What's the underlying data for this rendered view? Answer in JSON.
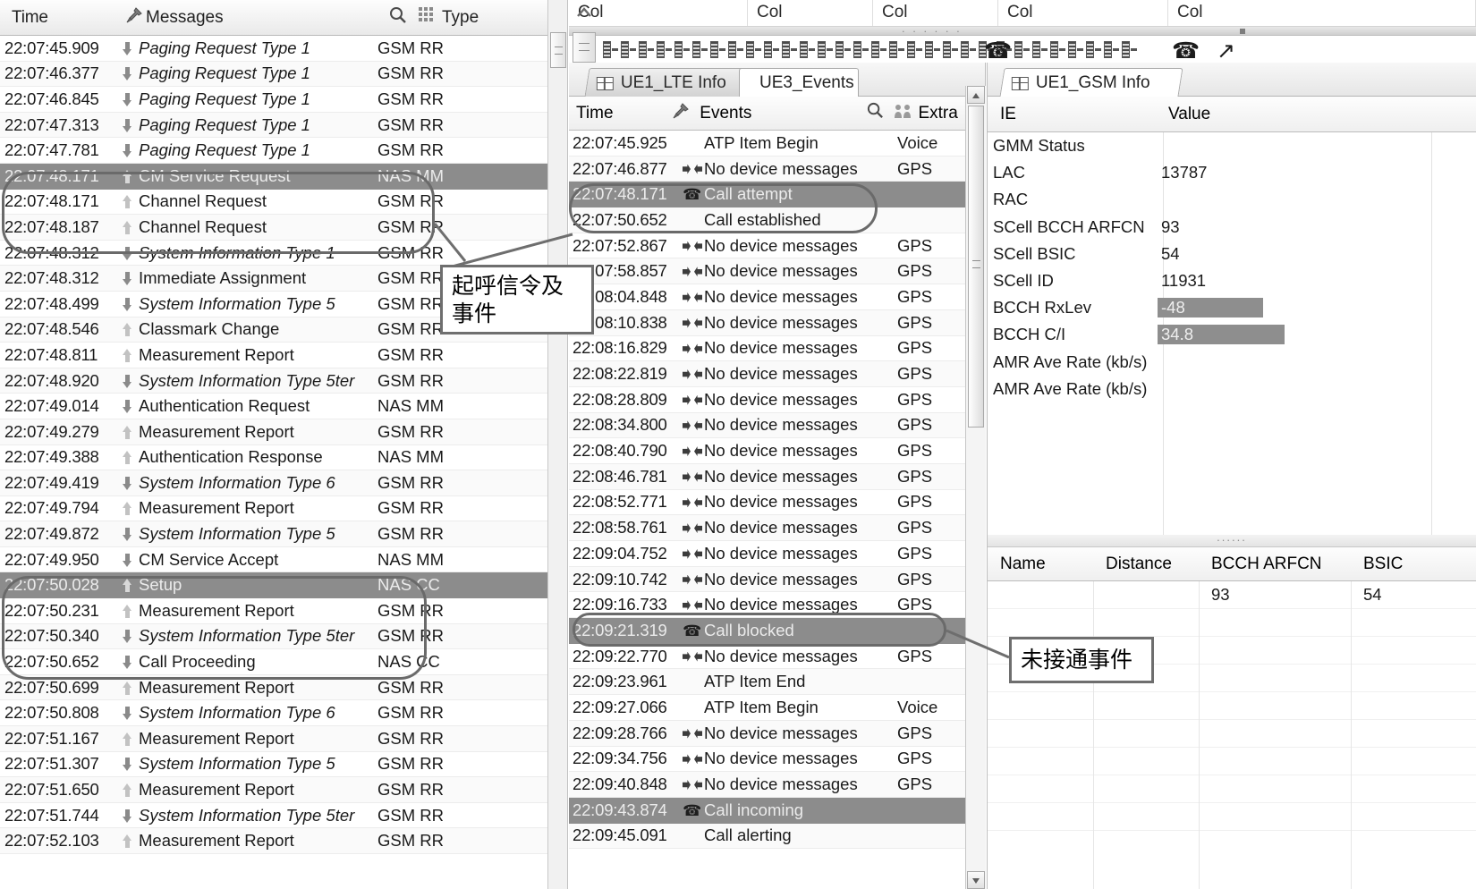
{
  "messages_panel": {
    "columns": [
      "Time",
      "Messages",
      "Type"
    ],
    "pin_icon": "pin-icon",
    "search_icon": "search-icon",
    "grid_icon": "grid-icon",
    "rows": [
      {
        "time": "22:07:45.909",
        "dir": "down",
        "msg": "Paging Request Type 1",
        "italic": true,
        "type": "GSM RR",
        "selected": false
      },
      {
        "time": "22:07:46.377",
        "dir": "down",
        "msg": "Paging Request Type 1",
        "italic": true,
        "type": "GSM RR",
        "selected": false
      },
      {
        "time": "22:07:46.845",
        "dir": "down",
        "msg": "Paging Request Type 1",
        "italic": true,
        "type": "GSM RR",
        "selected": false
      },
      {
        "time": "22:07:47.313",
        "dir": "down",
        "msg": "Paging Request Type 1",
        "italic": true,
        "type": "GSM RR",
        "selected": false
      },
      {
        "time": "22:07:47.781",
        "dir": "down",
        "msg": "Paging Request Type 1",
        "italic": true,
        "type": "GSM RR",
        "selected": false
      },
      {
        "time": "22:07:48.171",
        "dir": "up",
        "msg": "CM Service Request",
        "italic": false,
        "type": "NAS MM",
        "selected": true
      },
      {
        "time": "22:07:48.171",
        "dir": "up",
        "msg": "Channel Request",
        "italic": false,
        "type": "GSM RR",
        "selected": false
      },
      {
        "time": "22:07:48.187",
        "dir": "up",
        "msg": "Channel Request",
        "italic": false,
        "type": "GSM RR",
        "selected": false
      },
      {
        "time": "22:07:48.312",
        "dir": "down",
        "msg": "System Information Type 1",
        "italic": true,
        "type": "GSM RR",
        "selected": false
      },
      {
        "time": "22:07:48.312",
        "dir": "down",
        "msg": "Immediate Assignment",
        "italic": false,
        "type": "GSM RR",
        "selected": false
      },
      {
        "time": "22:07:48.499",
        "dir": "down",
        "msg": "System Information Type 5",
        "italic": true,
        "type": "GSM RR",
        "selected": false
      },
      {
        "time": "22:07:48.546",
        "dir": "up",
        "msg": "Classmark Change",
        "italic": false,
        "type": "GSM RR",
        "selected": false
      },
      {
        "time": "22:07:48.811",
        "dir": "up",
        "msg": "Measurement Report",
        "italic": false,
        "type": "GSM RR",
        "selected": false
      },
      {
        "time": "22:07:48.920",
        "dir": "down",
        "msg": "System Information Type 5ter",
        "italic": true,
        "type": "GSM RR",
        "selected": false
      },
      {
        "time": "22:07:49.014",
        "dir": "down",
        "msg": "Authentication Request",
        "italic": false,
        "type": "NAS MM",
        "selected": false
      },
      {
        "time": "22:07:49.279",
        "dir": "up",
        "msg": "Measurement Report",
        "italic": false,
        "type": "GSM RR",
        "selected": false
      },
      {
        "time": "22:07:49.388",
        "dir": "up",
        "msg": "Authentication Response",
        "italic": false,
        "type": "NAS MM",
        "selected": false
      },
      {
        "time": "22:07:49.419",
        "dir": "down",
        "msg": "System Information Type 6",
        "italic": true,
        "type": "GSM RR",
        "selected": false
      },
      {
        "time": "22:07:49.794",
        "dir": "up",
        "msg": "Measurement Report",
        "italic": false,
        "type": "GSM RR",
        "selected": false
      },
      {
        "time": "22:07:49.872",
        "dir": "down",
        "msg": "System Information Type 5",
        "italic": true,
        "type": "GSM RR",
        "selected": false
      },
      {
        "time": "22:07:49.950",
        "dir": "down",
        "msg": "CM Service Accept",
        "italic": false,
        "type": "NAS MM",
        "selected": false
      },
      {
        "time": "22:07:50.028",
        "dir": "up",
        "msg": "Setup",
        "italic": false,
        "type": "NAS CC",
        "selected": true
      },
      {
        "time": "22:07:50.231",
        "dir": "up",
        "msg": "Measurement Report",
        "italic": false,
        "type": "GSM RR",
        "selected": false
      },
      {
        "time": "22:07:50.340",
        "dir": "down",
        "msg": "System Information Type 5ter",
        "italic": true,
        "type": "GSM RR",
        "selected": false
      },
      {
        "time": "22:07:50.652",
        "dir": "down",
        "msg": "Call Proceeding",
        "italic": false,
        "type": "NAS CC",
        "selected": false
      },
      {
        "time": "22:07:50.699",
        "dir": "up",
        "msg": "Measurement Report",
        "italic": false,
        "type": "GSM RR",
        "selected": false
      },
      {
        "time": "22:07:50.808",
        "dir": "down",
        "msg": "System Information Type 6",
        "italic": true,
        "type": "GSM RR",
        "selected": false
      },
      {
        "time": "22:07:51.167",
        "dir": "up",
        "msg": "Measurement Report",
        "italic": false,
        "type": "GSM RR",
        "selected": false
      },
      {
        "time": "22:07:51.307",
        "dir": "down",
        "msg": "System Information Type 5",
        "italic": true,
        "type": "GSM RR",
        "selected": false
      },
      {
        "time": "22:07:51.650",
        "dir": "up",
        "msg": "Measurement Report",
        "italic": false,
        "type": "GSM RR",
        "selected": false
      },
      {
        "time": "22:07:51.744",
        "dir": "down",
        "msg": "System Information Type 5ter",
        "italic": true,
        "type": "GSM RR",
        "selected": false
      },
      {
        "time": "22:07:52.103",
        "dir": "up",
        "msg": "Measurement Report",
        "italic": false,
        "type": "GSM RR",
        "selected": false
      }
    ]
  },
  "top_strip": {
    "column_headers": [
      "Col",
      "Col",
      "Col",
      "Col",
      "Col"
    ],
    "timeline_row_number": "2"
  },
  "events_panel": {
    "tabs": [
      {
        "label": "UE1_LTE Info",
        "active": false
      },
      {
        "label": "UE3_Events",
        "active": true
      }
    ],
    "columns": [
      "Time",
      "Events",
      "Extra"
    ],
    "pin_icon": "pin-icon",
    "search_icon": "search-icon",
    "people_icon": "people-icon",
    "rows": [
      {
        "time": "22:07:45.925",
        "icon": "none",
        "event": "ATP Item Begin",
        "extra": "Voice",
        "selected": false
      },
      {
        "time": "22:07:46.877",
        "icon": "device",
        "event": "No device messages",
        "extra": "GPS",
        "selected": false
      },
      {
        "time": "22:07:48.171",
        "icon": "phone",
        "event": "Call attempt",
        "extra": "",
        "selected": true
      },
      {
        "time": "22:07:50.652",
        "icon": "none",
        "event": "Call established",
        "extra": "",
        "selected": false
      },
      {
        "time": "22:07:52.867",
        "icon": "device",
        "event": "No device messages",
        "extra": "GPS",
        "selected": false
      },
      {
        "time": "22:07:58.857",
        "icon": "device",
        "event": "No device messages",
        "extra": "GPS",
        "selected": false
      },
      {
        "time": "22:08:04.848",
        "icon": "device",
        "event": "No device messages",
        "extra": "GPS",
        "selected": false
      },
      {
        "time": "22:08:10.838",
        "icon": "device",
        "event": "No device messages",
        "extra": "GPS",
        "selected": false
      },
      {
        "time": "22:08:16.829",
        "icon": "device",
        "event": "No device messages",
        "extra": "GPS",
        "selected": false
      },
      {
        "time": "22:08:22.819",
        "icon": "device",
        "event": "No device messages",
        "extra": "GPS",
        "selected": false
      },
      {
        "time": "22:08:28.809",
        "icon": "device",
        "event": "No device messages",
        "extra": "GPS",
        "selected": false
      },
      {
        "time": "22:08:34.800",
        "icon": "device",
        "event": "No device messages",
        "extra": "GPS",
        "selected": false
      },
      {
        "time": "22:08:40.790",
        "icon": "device",
        "event": "No device messages",
        "extra": "GPS",
        "selected": false
      },
      {
        "time": "22:08:46.781",
        "icon": "device",
        "event": "No device messages",
        "extra": "GPS",
        "selected": false
      },
      {
        "time": "22:08:52.771",
        "icon": "device",
        "event": "No device messages",
        "extra": "GPS",
        "selected": false
      },
      {
        "time": "22:08:58.761",
        "icon": "device",
        "event": "No device messages",
        "extra": "GPS",
        "selected": false
      },
      {
        "time": "22:09:04.752",
        "icon": "device",
        "event": "No device messages",
        "extra": "GPS",
        "selected": false
      },
      {
        "time": "22:09:10.742",
        "icon": "device",
        "event": "No device messages",
        "extra": "GPS",
        "selected": false
      },
      {
        "time": "22:09:16.733",
        "icon": "device",
        "event": "No device messages",
        "extra": "GPS",
        "selected": false
      },
      {
        "time": "22:09:21.319",
        "icon": "phone",
        "event": "Call blocked",
        "extra": "",
        "selected": true
      },
      {
        "time": "22:09:22.770",
        "icon": "device",
        "event": "No device messages",
        "extra": "GPS",
        "selected": false
      },
      {
        "time": "22:09:23.961",
        "icon": "none",
        "event": "ATP Item End",
        "extra": "",
        "selected": false
      },
      {
        "time": "22:09:27.066",
        "icon": "none",
        "event": "ATP Item Begin",
        "extra": "Voice",
        "selected": false
      },
      {
        "time": "22:09:28.766",
        "icon": "device",
        "event": "No device messages",
        "extra": "GPS",
        "selected": false
      },
      {
        "time": "22:09:34.756",
        "icon": "device",
        "event": "No device messages",
        "extra": "GPS",
        "selected": false
      },
      {
        "time": "22:09:40.848",
        "icon": "device",
        "event": "No device messages",
        "extra": "GPS",
        "selected": false
      },
      {
        "time": "22:09:43.874",
        "icon": "phone",
        "event": "Call incoming",
        "extra": "",
        "selected": true
      },
      {
        "time": "22:09:45.091",
        "icon": "none",
        "event": "Call alerting",
        "extra": "",
        "selected": false
      }
    ]
  },
  "gsm_info_panel": {
    "tabs": [
      {
        "label": "UE1_GSM Info",
        "active": true
      }
    ],
    "columns": [
      "IE",
      "Value"
    ],
    "rows": [
      {
        "ie": "GMM Status",
        "value": "",
        "highlight": false
      },
      {
        "ie": "LAC",
        "value": "13787",
        "highlight": false
      },
      {
        "ie": "RAC",
        "value": "",
        "highlight": false
      },
      {
        "ie": "SCell BCCH ARFCN",
        "value": "93",
        "highlight": false
      },
      {
        "ie": "SCell BSIC",
        "value": "54",
        "highlight": false
      },
      {
        "ie": "SCell ID",
        "value": "11931",
        "highlight": false
      },
      {
        "ie": "BCCH RxLev",
        "value": "-48",
        "highlight": true,
        "hl_width": 118
      },
      {
        "ie": "BCCH C/I",
        "value": "34.8",
        "highlight": true,
        "hl_width": 142
      },
      {
        "ie": "AMR Ave Rate (kb/s)",
        "value": "",
        "highlight": false
      },
      {
        "ie": "AMR Ave Rate (kb/s)",
        "value": "",
        "highlight": false
      }
    ]
  },
  "neighbor_panel": {
    "columns": [
      "Name",
      "Distance",
      "BCCH ARFCN",
      "BSIC"
    ],
    "rows": [
      {
        "name": "",
        "distance": "",
        "bcch_arfcn": "93",
        "bsic": "54"
      },
      {
        "name": "",
        "distance": "",
        "bcch_arfcn": "",
        "bsic": ""
      },
      {
        "name": "",
        "distance": "",
        "bcch_arfcn": "",
        "bsic": ""
      },
      {
        "name": "",
        "distance": "",
        "bcch_arfcn": "",
        "bsic": ""
      },
      {
        "name": "",
        "distance": "",
        "bcch_arfcn": "",
        "bsic": ""
      },
      {
        "name": "",
        "distance": "",
        "bcch_arfcn": "",
        "bsic": ""
      },
      {
        "name": "",
        "distance": "",
        "bcch_arfcn": "",
        "bsic": ""
      },
      {
        "name": "",
        "distance": "",
        "bcch_arfcn": "",
        "bsic": ""
      },
      {
        "name": "",
        "distance": "",
        "bcch_arfcn": "",
        "bsic": ""
      }
    ]
  },
  "annotations": [
    {
      "id": "call-origination",
      "text": "起呼信令及事件"
    },
    {
      "id": "call-not-connected",
      "text": "未接通事件"
    }
  ],
  "colors": {
    "selection_gray": "#8c8c8c",
    "highlight_gray": "#8e8e8e",
    "annotation_border": "#6e6e6e",
    "panel_border": "#bdbdbd"
  }
}
